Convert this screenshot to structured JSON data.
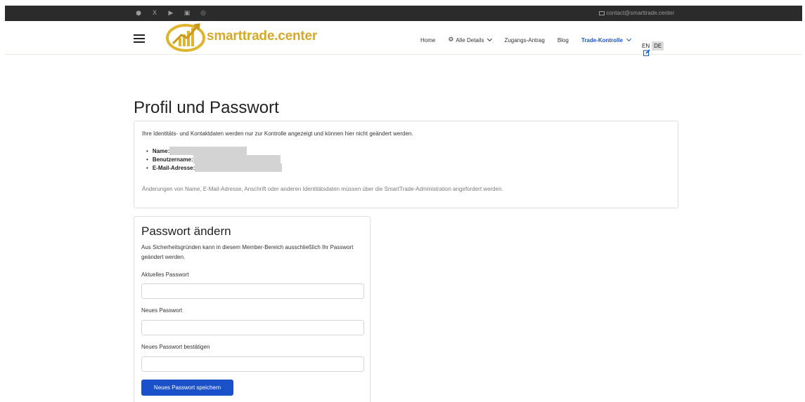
{
  "topbar": {
    "social_icons": [
      "facebook-icon",
      "x-icon",
      "youtube-icon",
      "linkedin-icon",
      "instagram-icon"
    ],
    "social_glyphs": [
      "●",
      "X",
      "▶",
      "▣",
      "◎"
    ],
    "contact_email": "contact@smarttrade.center"
  },
  "header": {
    "logo_text": "smarttrade.center",
    "brand_color": "#d4a829",
    "nav": {
      "home": "Home",
      "details": "Alle Details",
      "access": "Zugangs-Antrag",
      "blog": "Blog",
      "trade_control": "Trade-Kontrolle"
    },
    "lang": {
      "en": "EN",
      "de": "DE",
      "active": "DE"
    }
  },
  "page": {
    "title": "Profil und Passwort",
    "identity": {
      "intro": "Ihre Identitäts- und Kontaktdaten werden nur zur Kontrolle angezeigt und können hier nicht geändert werden.",
      "name_label": "Name:",
      "username_label": "Benutzername:",
      "email_label": "E-Mail-Adresse:",
      "note": "Änderungen von Name, E-Mail-Adresse, Anschrift oder anderen Identitätsdaten müssen über die SmartTrade-Administration angefordert werden."
    },
    "password": {
      "title": "Passwort ändern",
      "description": "Aus Sicherheitsgründen kann in diesem Member-Bereich ausschließlich Ihr Passwort geändert werden.",
      "current_label": "Aktuelles Passwort",
      "current_value": "",
      "new_label": "Neues Passwort",
      "new_value": "",
      "confirm_label": "Neues Passwort bestätigen",
      "confirm_value": "",
      "save_button": "Neues Passwort speichern"
    }
  },
  "colors": {
    "accent": "#1a51c9",
    "active_nav": "#1a56c4",
    "topbar": "#2b2b2b"
  }
}
